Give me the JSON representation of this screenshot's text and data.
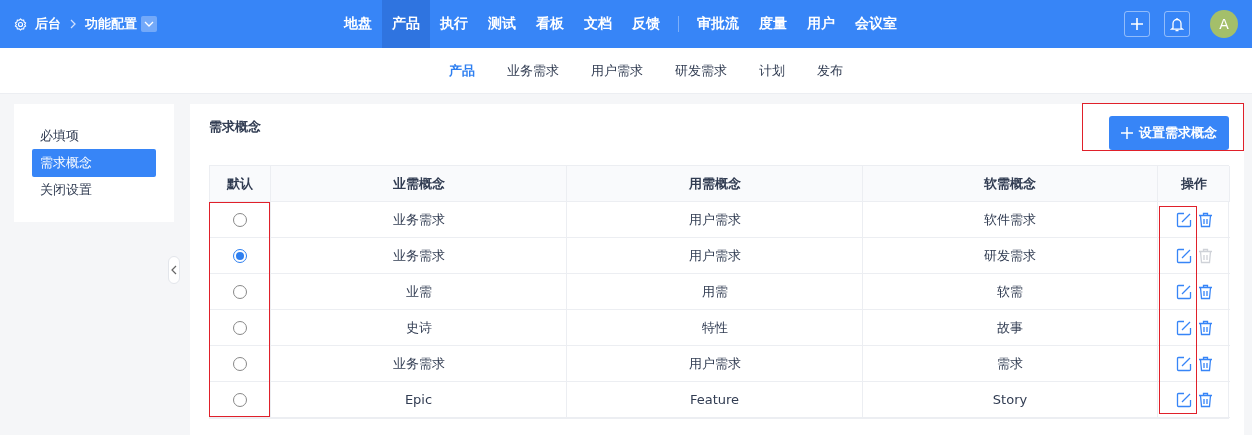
{
  "header": {
    "breadcrumb": [
      "后台",
      "功能配置"
    ],
    "nav_groups": [
      [
        {
          "label": "地盘",
          "selected": false
        },
        {
          "label": "产品",
          "selected": true
        },
        {
          "label": "执行",
          "selected": false
        },
        {
          "label": "测试",
          "selected": false
        },
        {
          "label": "看板",
          "selected": false
        },
        {
          "label": "文档",
          "selected": false
        },
        {
          "label": "反馈",
          "selected": false
        }
      ],
      [
        {
          "label": "审批流",
          "selected": false
        },
        {
          "label": "度量",
          "selected": false
        },
        {
          "label": "用户",
          "selected": false
        },
        {
          "label": "会议室",
          "selected": false
        }
      ]
    ],
    "avatar": "A"
  },
  "subnav": [
    {
      "label": "产品",
      "selected": true
    },
    {
      "label": "业务需求",
      "selected": false
    },
    {
      "label": "用户需求",
      "selected": false
    },
    {
      "label": "研发需求",
      "selected": false
    },
    {
      "label": "计划",
      "selected": false
    },
    {
      "label": "发布",
      "selected": false
    }
  ],
  "sidebar": {
    "items": [
      {
        "label": "必填项",
        "selected": false
      },
      {
        "label": "需求概念",
        "selected": true
      },
      {
        "label": "关闭设置",
        "selected": false
      }
    ]
  },
  "panel": {
    "title": "需求概念",
    "add_button": {
      "label": "设置需求概念",
      "highlighted": true
    },
    "table": {
      "columns": [
        "默认",
        "业需概念",
        "用需概念",
        "软需概念",
        "操作"
      ],
      "default_column_highlighted": true,
      "edit_icons_highlighted": true,
      "rows": [
        {
          "selected": false,
          "cells": [
            "",
            "业务需求",
            "用户需求",
            "软件需求"
          ],
          "delete_disabled": false
        },
        {
          "selected": true,
          "cells": [
            "",
            "业务需求",
            "用户需求",
            "研发需求"
          ],
          "delete_disabled": true
        },
        {
          "selected": false,
          "cells": [
            "",
            "业需",
            "用需",
            "软需"
          ],
          "delete_disabled": false
        },
        {
          "selected": false,
          "cells": [
            "",
            "史诗",
            "特性",
            "故事"
          ],
          "delete_disabled": false
        },
        {
          "selected": false,
          "cells": [
            "",
            "业务需求",
            "用户需求",
            "需求"
          ],
          "delete_disabled": false
        },
        {
          "selected": false,
          "cells": [
            "",
            "Epic",
            "Feature",
            "Story"
          ],
          "delete_disabled": false
        }
      ]
    }
  }
}
